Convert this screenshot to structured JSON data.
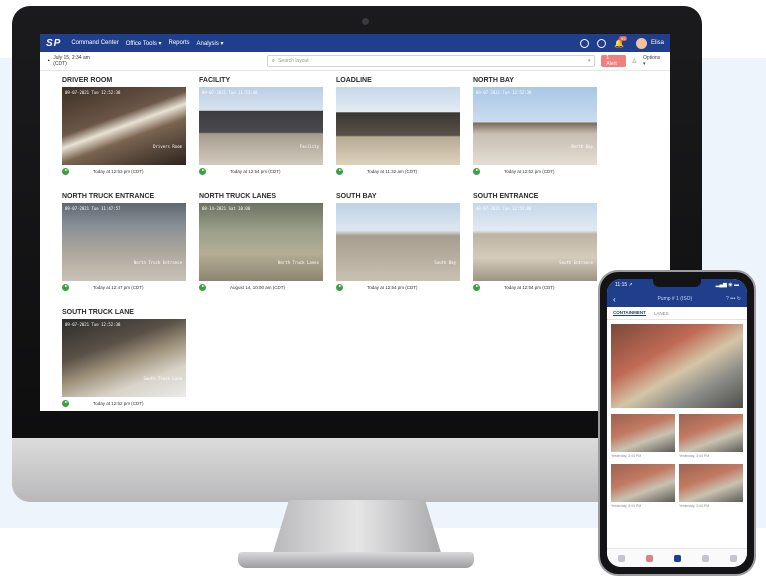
{
  "nav": {
    "logo": "SP",
    "items": [
      "Command Center",
      "Office Tools ▾",
      "Reports",
      "Analysis ▾"
    ],
    "notification_count": "99",
    "user_name": "Elisa"
  },
  "toolbar": {
    "timestamp": "July 15, 2:34 am (CDT)",
    "search_placeholder": "Search layout",
    "alert_label": "1 Alert",
    "options_label": "Options ▾"
  },
  "cameras": [
    {
      "title": "DRIVER ROOM",
      "overlay_ts": "09-07-2021 Tue 12:52:38",
      "overlay_label": "Drivers Room",
      "updated": "Today at 12:53 pm (CDT)"
    },
    {
      "title": "FACILITY",
      "overlay_ts": "09-07-2021 Tue 11:53:48",
      "overlay_label": "Facility",
      "updated": "Today at 12:54 pm (CDT)"
    },
    {
      "title": "LOADLINE",
      "overlay_ts": "",
      "overlay_label": "",
      "updated": "Today at 11:32 am (CDT)"
    },
    {
      "title": "NORTH BAY",
      "overlay_ts": "09-07-2021 Tue 12:52:38",
      "overlay_label": "North Bay",
      "updated": "Today at 12:52 pm (CDT)"
    },
    {
      "title": "NORTH TRUCK ENTRANCE",
      "overlay_ts": "09-07-2021 Tue 11:47:57",
      "overlay_label": "North Truck Entrance",
      "updated": "Today at 12:47 pm (CDT)"
    },
    {
      "title": "NORTH TRUCK LANES",
      "overlay_ts": "08-14-2021 Sat 10:00",
      "overlay_label": "North Truck Lanes",
      "updated": "August 14, 10:00 am (CDT)"
    },
    {
      "title": "SOUTH BAY",
      "overlay_ts": "",
      "overlay_label": "South Bay",
      "updated": "Today at 12:54 pm (CDT)"
    },
    {
      "title": "SOUTH ENTRANCE",
      "overlay_ts": "09-07-2021 Tue 12:54:08",
      "overlay_label": "South Entrance",
      "updated": "Today at 12:54 pm (CDT)"
    },
    {
      "title": "SOUTH TRUCK LANE",
      "overlay_ts": "09-07-2021 Tue 12:52:38",
      "overlay_label": "South Truck Lane",
      "updated": "Today at 12:52 pm (CDT)"
    }
  ],
  "phone": {
    "time": "11:15 ↗",
    "signal": "▂▄▆ ◉ ▬",
    "header_title": "Pump # 1 (ISO)",
    "header_right": "? ••• ↻",
    "tabs": [
      "CONTAINMENT",
      "LANES"
    ],
    "thumb_caption": "Yesterday, 3:44 PM"
  }
}
